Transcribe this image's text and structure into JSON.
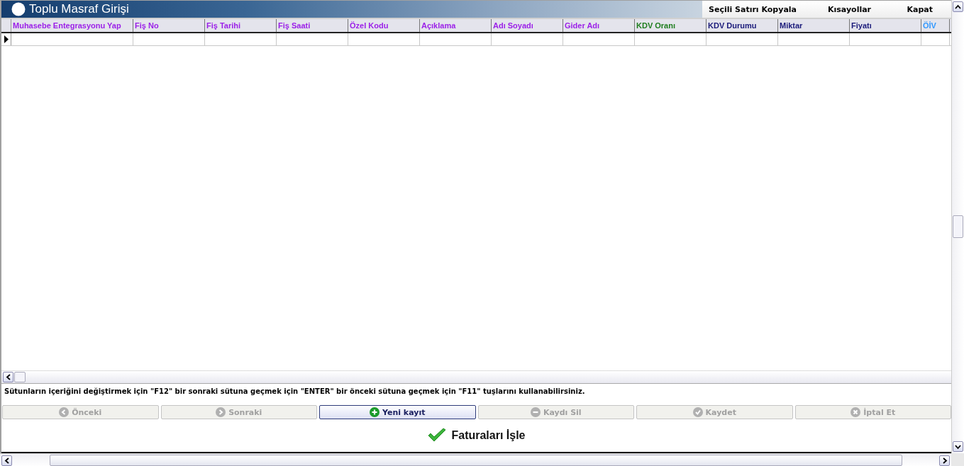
{
  "window": {
    "title": "Toplu Masraf Girişi"
  },
  "menu": [
    "Seçili Satırı Kopyala",
    "Kısayollar",
    "Kapat"
  ],
  "table": {
    "columns": [
      {
        "label": "Muhasebe Entegrasyonu Yap",
        "color": "#9b1fe8"
      },
      {
        "label": "Fiş No",
        "color": "#9b1fe8"
      },
      {
        "label": "Fiş Tarihi",
        "color": "#9b1fe8"
      },
      {
        "label": "Fiş Saati",
        "color": "#9b1fe8"
      },
      {
        "label": "Özel Kodu",
        "color": "#9b1fe8"
      },
      {
        "label": "Açıklama",
        "color": "#9b1fe8"
      },
      {
        "label": "Adı Soyadı",
        "color": "#9b1fe8"
      },
      {
        "label": "Gider Adı",
        "color": "#9b1fe8"
      },
      {
        "label": "KDV Oranı",
        "color": "#1e7d1e"
      },
      {
        "label": "KDV Durumu",
        "color": "#1a1a7a"
      },
      {
        "label": "Miktar",
        "color": "#1a1a7a"
      },
      {
        "label": "Fiyatı",
        "color": "#1a1a7a"
      },
      {
        "label": "ÖİV",
        "color": "#3399ff"
      }
    ]
  },
  "hint": "Sütunların içeriğini değiştirmek için \"F12\" bir sonraki sütuna geçmek için \"ENTER\" bir önceki sütuna geçmek için \"F11\" tuşlarını kullanabilirsiniz.",
  "buttons": [
    {
      "label": "Önceki",
      "kind": "previous",
      "disabled": true
    },
    {
      "label": "Sonraki",
      "kind": "next",
      "disabled": true
    },
    {
      "label": "Yeni kayıt",
      "kind": "add",
      "disabled": false
    },
    {
      "label": "Kaydı Sil",
      "kind": "delete",
      "disabled": true
    },
    {
      "label": "Kaydet",
      "kind": "save",
      "disabled": true
    },
    {
      "label": "İptal Et",
      "kind": "cancel",
      "disabled": true
    }
  ],
  "process_button": {
    "label": "Faturaları İşle"
  }
}
